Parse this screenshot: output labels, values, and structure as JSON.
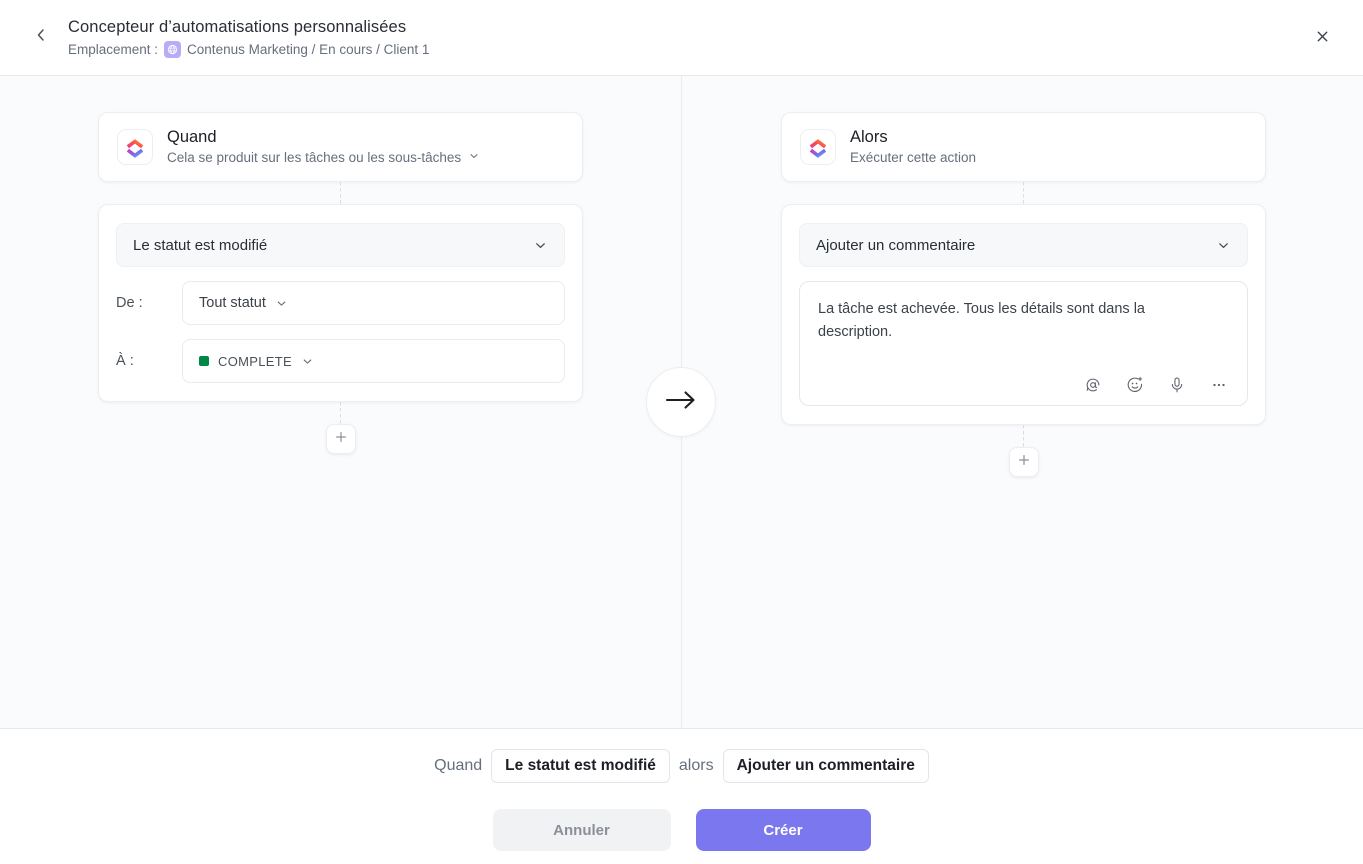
{
  "header": {
    "back_icon": "chevron-left-icon",
    "title": "Concepteur d’automatisations personnalisées",
    "location_label": "Emplacement :",
    "location_icon": "globe-icon",
    "breadcrumb": "Contenus Marketing / En cours / Client 1",
    "close_icon": "close-icon"
  },
  "canvas": {
    "when": {
      "logo_icon": "clickup-logo-icon",
      "title": "Quand",
      "subtitle": "Cela se produit sur les tâches ou les sous-tâches",
      "subtitle_chevron": "chevron-down-icon",
      "trigger": {
        "value": "Le statut est modifié",
        "chevron": "chevron-down-icon"
      },
      "fields": [
        {
          "label": "De :",
          "value": "Tout statut",
          "has_status_dot": false,
          "chevron": "chevron-down-icon"
        },
        {
          "label": "À :",
          "value": "COMPLETE",
          "has_status_dot": true,
          "status_color": "#008844",
          "chevron": "chevron-down-icon"
        }
      ],
      "add_button_icon": "plus-icon"
    },
    "then": {
      "logo_icon": "clickup-logo-icon",
      "title": "Alors",
      "subtitle": "Exécuter cette action",
      "action": {
        "value": "Ajouter un commentaire",
        "chevron": "chevron-down-icon"
      },
      "comment": {
        "text": "La tâche est achevée. Tous les détails sont dans la description.",
        "placeholder": "Ajouter un commentaire",
        "toolbar": [
          {
            "icon": "mention-icon"
          },
          {
            "icon": "emoji-add-icon"
          },
          {
            "icon": "microphone-icon"
          },
          {
            "icon": "more-options-icon"
          }
        ]
      },
      "add_button_icon": "plus-icon"
    },
    "flow_arrow_icon": "arrow-right-icon"
  },
  "footer": {
    "summary": {
      "when_word": "Quand",
      "trigger_chip": "Le statut est modifié",
      "then_word": "alors",
      "action_chip": "Ajouter un commentaire"
    },
    "cancel_label": "Annuler",
    "create_label": "Créer",
    "accent_color": "#7b77ef"
  }
}
